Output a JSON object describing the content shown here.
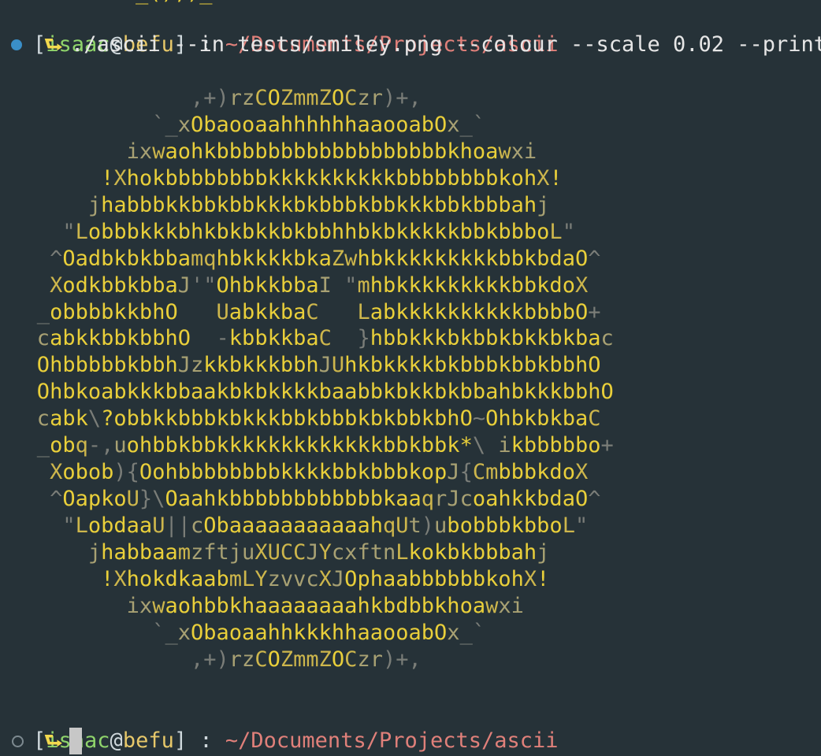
{
  "prompt": {
    "bracket_open": "[",
    "user": "isaac",
    "at": "@",
    "host": "befu",
    "bracket_close": "]",
    "separator": " : ",
    "path": "~/Documents/Projects/ascii"
  },
  "command": "./ascii --in tests/smiley.png --colour --scale 0.02 --print",
  "prompt_arrow_icon": "return-arrow-icon",
  "art_lines": [
    "               ,+)rzCOZmmZOCzr)+,",
    "            `_xObaooaahhhhhhaaooabOx_`",
    "          ixwaohkbbbbbbbbbbbbbbbbbbkhoawxi",
    "        !XhokbbbbbbbbkkkkkkkkkkbbbbbbbbkohX!",
    "       jhabbbkkbbkbbkkkbkbbbkbbkkkbbkbbbahj",
    "     \"LobbbkkkbhkbkbkkbkbbhhbkbkkkkkbbkbbboL\"",
    "    ^OadbkbkbbamqhbkkkkbkaZwhbkkkkkkkkkbbkbdaO^",
    "    XodkbbkbbaJ'\"OhbkkbbaI \"mhbkkkkkkkkkbbkdoX",
    "   _obbbbkkbhO   UabkkbaC   LabkkkkkkkkkkbbbbO+",
    "   cabkkbbkbbhO  -kbbkkbaC  }hbbkkkbkbbkbkkbkbac",
    "   OhbbbbbkbbhJzkkbkkkbbhJUhkbkkkkbkbbbkbbkbbhO",
    "   OhbkoabkkkbbaakbkbkkkkbaabbkbkkbkbbahbkkkbbhO",
    "   cabk\\?obbkkbbbkbkkkbbkbbbkbkbbkbhO~OhbkbkbaC",
    "   _obq-,uohbbkbbkkkkkkkkkkkkkbbkbbk*\\ ikbbbbbo+",
    "    Xobob){OohbbbbbbbbkkkkbbkbbbkopJ{CmbbbkdoX",
    "    ^OapkoU}\\OaahkbbbbbbbbbbbbkaaqrJcoahkkbdaO^",
    "     \"LobdaaU||cObaaaaaaaaaaahqUt)ubobbbkbboL\"",
    "       jhabbaamzftjuXUCCJYcxftnLkokbkbbbahj",
    "        !XhokdkaabmLYzvvcXJOphaabbbbbbkohX!",
    "          ixwaohbbkhaaaaaaaahkbdbbkhoawxi",
    "            `_xObaoaahhkkkhhaaooabOx_`",
    "               ,+)rzCOZmmZOCzr)+,"
  ],
  "colors": {
    "background": "#263238",
    "art": "#e9cf3a",
    "user": "#8fd46b",
    "host": "#e7c86a",
    "path": "#e0807a",
    "arrow": "#f2d94e",
    "status_dot_active": "#3a8fc8"
  }
}
